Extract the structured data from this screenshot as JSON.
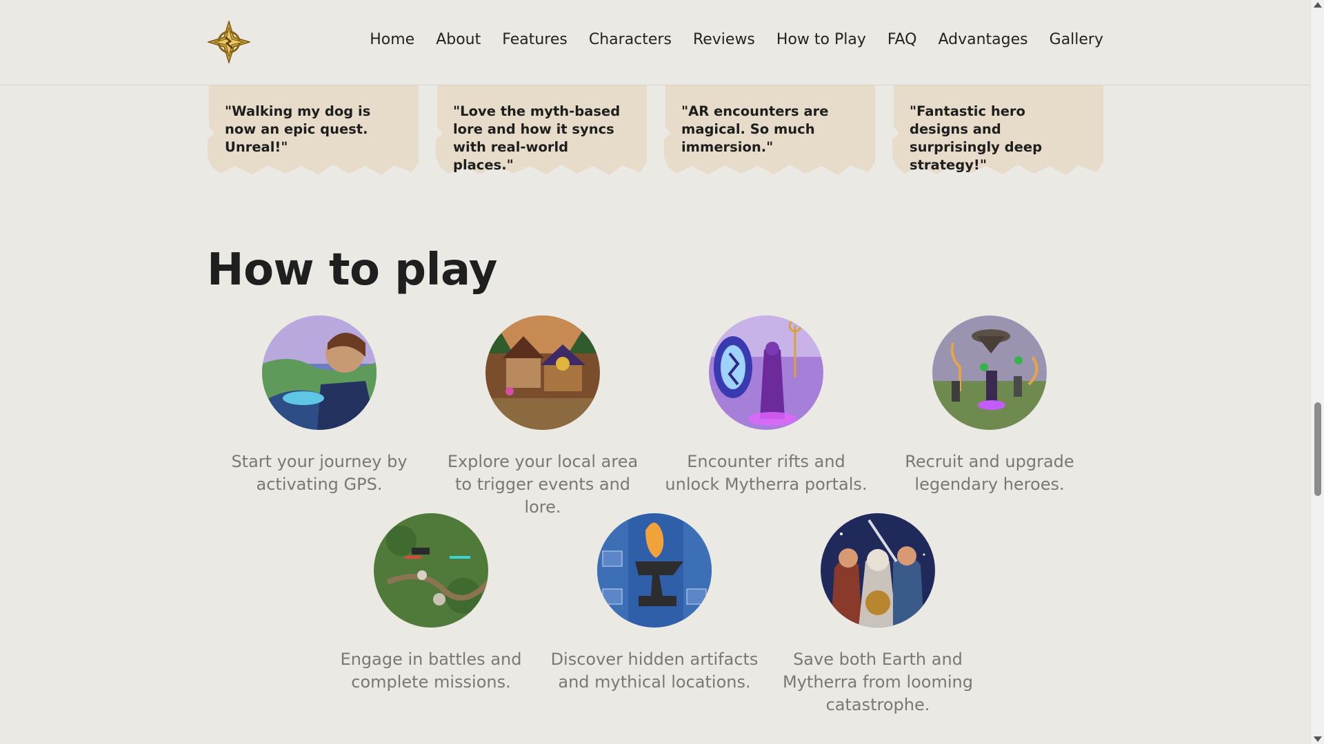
{
  "header": {
    "logo_icon": "compass-star-logo",
    "nav": [
      "Home",
      "About",
      "Features",
      "Characters",
      "Reviews",
      "How to Play",
      "FAQ",
      "Advantages",
      "Gallery"
    ]
  },
  "reviews": [
    "\"Walking my dog is now an epic quest. Unreal!\"",
    "\"Love the myth-based lore and how it syncs with real-world places.\"",
    "\"AR encounters are magical. So much immersion.\"",
    "\"Fantastic hero designs and surprisingly deep strategy!\""
  ],
  "how_to_play": {
    "title": "How to play",
    "steps": [
      {
        "text": "Start your journey by activating GPS.",
        "image": "hero-with-map-illustration"
      },
      {
        "text": "Explore your local area to trigger events and lore.",
        "image": "fantasy-village-illustration"
      },
      {
        "text": "Encounter rifts and unlock Mytherra portals.",
        "image": "purple-portal-illustration"
      },
      {
        "text": "Recruit and upgrade legendary heroes.",
        "image": "heroes-on-floating-island-illustration"
      },
      {
        "text": "Engage in battles and complete missions.",
        "image": "battle-map-illustration"
      },
      {
        "text": "Discover hidden artifacts and mythical locations.",
        "image": "anvil-forge-illustration"
      },
      {
        "text": "Save both Earth and Mytherra from looming catastrophe.",
        "image": "hero-party-illustration"
      }
    ]
  },
  "colors": {
    "background": "#ebe9e4",
    "card": "#e6dcc9",
    "muted_text": "#7a7870",
    "logo_gold": "#c9a13b"
  }
}
